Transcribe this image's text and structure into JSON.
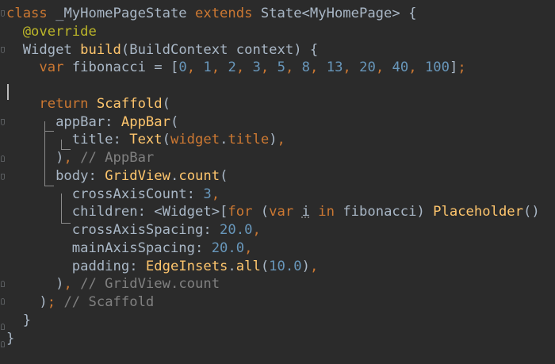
{
  "editor": {
    "language": "Dart",
    "theme": "Darcula",
    "colors": {
      "background": "#2b2b2b",
      "keyword": "#cc7832",
      "class_name": "#ffc66d",
      "annotation": "#bbb529",
      "number": "#6897bb",
      "comment": "#808080",
      "identifier": "#a9b7c6"
    },
    "lines": [
      [
        {
          "t": "class ",
          "c": "kw"
        },
        {
          "t": "_MyHomePageState ",
          "c": "txt"
        },
        {
          "t": "extends ",
          "c": "kw"
        },
        {
          "t": "State<MyHomePage> {",
          "c": "txt"
        }
      ],
      [
        {
          "t": "  ",
          "c": "txt"
        },
        {
          "t": "@override",
          "c": "ann"
        }
      ],
      [
        {
          "t": "  Widget ",
          "c": "txt"
        },
        {
          "t": "build",
          "c": "fn"
        },
        {
          "t": "(BuildContext context) {",
          "c": "txt"
        }
      ],
      [
        {
          "t": "    ",
          "c": "txt"
        },
        {
          "t": "var ",
          "c": "kw"
        },
        {
          "t": "fibonacci = [",
          "c": "txt"
        },
        {
          "t": "0",
          "c": "num"
        },
        {
          "t": ", ",
          "c": "kw"
        },
        {
          "t": "1",
          "c": "num"
        },
        {
          "t": ", ",
          "c": "kw"
        },
        {
          "t": "2",
          "c": "num"
        },
        {
          "t": ", ",
          "c": "kw"
        },
        {
          "t": "3",
          "c": "num"
        },
        {
          "t": ", ",
          "c": "kw"
        },
        {
          "t": "5",
          "c": "num"
        },
        {
          "t": ", ",
          "c": "kw"
        },
        {
          "t": "8",
          "c": "num"
        },
        {
          "t": ", ",
          "c": "kw"
        },
        {
          "t": "13",
          "c": "num"
        },
        {
          "t": ", ",
          "c": "kw"
        },
        {
          "t": "20",
          "c": "num"
        },
        {
          "t": ", ",
          "c": "kw"
        },
        {
          "t": "40",
          "c": "num"
        },
        {
          "t": ", ",
          "c": "kw"
        },
        {
          "t": "100",
          "c": "num"
        },
        {
          "t": "]",
          "c": "txt"
        },
        {
          "t": ";",
          "c": "kw"
        }
      ],
      [],
      [
        {
          "t": "    ",
          "c": "txt"
        },
        {
          "t": "return ",
          "c": "kw"
        },
        {
          "t": "Scaffold",
          "c": "cls"
        },
        {
          "t": "(",
          "c": "txt"
        }
      ],
      [
        {
          "t": "      appBar: ",
          "c": "txt"
        },
        {
          "t": "AppBar",
          "c": "cls"
        },
        {
          "t": "(",
          "c": "txt"
        }
      ],
      [
        {
          "t": "        title: ",
          "c": "txt"
        },
        {
          "t": "Text",
          "c": "cls"
        },
        {
          "t": "(",
          "c": "txt"
        },
        {
          "t": "widget",
          "c": "kw"
        },
        {
          "t": ".",
          "c": "txt"
        },
        {
          "t": "title",
          "c": "kw"
        },
        {
          "t": ")",
          "c": "txt"
        },
        {
          "t": ",",
          "c": "kw"
        }
      ],
      [
        {
          "t": "      )",
          "c": "txt"
        },
        {
          "t": ", ",
          "c": "kw"
        },
        {
          "t": "// AppBar",
          "c": "cmt"
        }
      ],
      [
        {
          "t": "      body: ",
          "c": "txt"
        },
        {
          "t": "GridView",
          "c": "cls"
        },
        {
          "t": ".",
          "c": "txt"
        },
        {
          "t": "count",
          "c": "cls"
        },
        {
          "t": "(",
          "c": "txt"
        }
      ],
      [
        {
          "t": "        crossAxisCount: ",
          "c": "txt"
        },
        {
          "t": "3",
          "c": "num"
        },
        {
          "t": ",",
          "c": "kw"
        }
      ],
      [
        {
          "t": "        children: <Widget>[",
          "c": "txt"
        },
        {
          "t": "for ",
          "c": "kw"
        },
        {
          "t": "(",
          "c": "txt"
        },
        {
          "t": "var ",
          "c": "kw"
        },
        {
          "t": "i",
          "c": "txt warn"
        },
        {
          "t": " in ",
          "c": "kw"
        },
        {
          "t": "fibonacci) ",
          "c": "txt"
        },
        {
          "t": "Placeholder",
          "c": "cls"
        },
        {
          "t": "()",
          "c": "txt"
        }
      ],
      [
        {
          "t": "        crossAxisSpacing: ",
          "c": "txt"
        },
        {
          "t": "20.0",
          "c": "num"
        },
        {
          "t": ",",
          "c": "kw"
        }
      ],
      [
        {
          "t": "        mainAxisSpacing: ",
          "c": "txt"
        },
        {
          "t": "20.0",
          "c": "num"
        },
        {
          "t": ",",
          "c": "kw"
        }
      ],
      [
        {
          "t": "        padding: ",
          "c": "txt"
        },
        {
          "t": "EdgeInsets",
          "c": "cls"
        },
        {
          "t": ".",
          "c": "txt"
        },
        {
          "t": "all",
          "c": "cls"
        },
        {
          "t": "(",
          "c": "txt"
        },
        {
          "t": "10.0",
          "c": "num"
        },
        {
          "t": ")",
          "c": "txt"
        },
        {
          "t": ",",
          "c": "kw"
        }
      ],
      [
        {
          "t": "      )",
          "c": "txt"
        },
        {
          "t": ", ",
          "c": "kw"
        },
        {
          "t": "// GridView.count",
          "c": "cmt"
        }
      ],
      [
        {
          "t": "    )",
          "c": "txt"
        },
        {
          "t": "; ",
          "c": "kw"
        },
        {
          "t": "// Scaffold",
          "c": "cmt"
        }
      ],
      [
        {
          "t": "  }",
          "c": "txt"
        }
      ],
      [
        {
          "t": "}",
          "c": "txt"
        }
      ]
    ]
  }
}
